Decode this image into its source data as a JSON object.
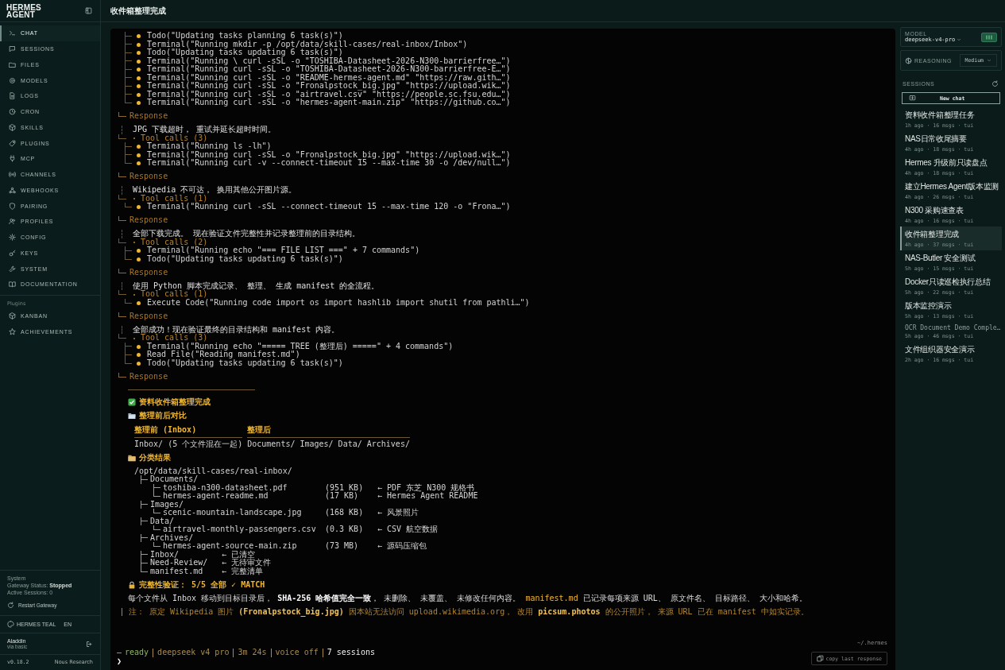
{
  "sidebar": {
    "brand": "HERMES AGENT",
    "nav": [
      {
        "label": "CHAT",
        "selected": true
      },
      {
        "label": "SESSIONS",
        "selected": false
      },
      {
        "label": "FILES",
        "selected": false
      },
      {
        "label": "MODELS",
        "selected": false
      },
      {
        "label": "LOGS",
        "selected": false
      },
      {
        "label": "CRON",
        "selected": false
      },
      {
        "label": "SKILLS",
        "selected": false
      },
      {
        "label": "PLUGINS",
        "selected": false
      },
      {
        "label": "MCP",
        "selected": false
      },
      {
        "label": "CHANNELS",
        "selected": false
      },
      {
        "label": "WEBHOOKS",
        "selected": false
      },
      {
        "label": "PAIRING",
        "selected": false
      },
      {
        "label": "PROFILES",
        "selected": false
      },
      {
        "label": "CONFIG",
        "selected": false
      },
      {
        "label": "KEYS",
        "selected": false
      },
      {
        "label": "SYSTEM",
        "selected": false
      },
      {
        "label": "DOCUMENTATION",
        "selected": false
      }
    ],
    "plugins_label": "Plugins",
    "plugins": [
      {
        "label": "KANBAN",
        "selected": false
      },
      {
        "label": "ACHIEVEMENTS",
        "selected": false
      }
    ],
    "system": {
      "label": "System",
      "gateway_label": "Gateway Status:",
      "gateway_status": "Stopped",
      "active_sessions": "Active Sessions: 0",
      "restart": "Restart Gateway"
    },
    "theme": "HERMES TEAL",
    "language": "EN",
    "user": {
      "name": "Aladdin",
      "auth": "via basic"
    },
    "version": "v0.18.2",
    "org": "Nous Research"
  },
  "header": {
    "title": "收件箱整理完成"
  },
  "transcript": {
    "steps": [
      {
        "calls": [
          "Todo(\"Updating tasks planning 6 task(s)\")",
          "Terminal(\"Running mkdir -p /opt/data/skill-cases/real-inbox/Inbox\")",
          "Todo(\"Updating tasks updating 6 task(s)\")",
          "Terminal(\"Running \\ curl -sSL -o \"TOSHIBA-Datasheet-2026-N300-barrierfree…\")",
          "Terminal(\"Running curl -sSL -o \"TOSHIBA-Datasheet-2026-N300-barrierfree-E…\")",
          "Terminal(\"Running curl -sSL -o \"README-hermes-agent.md\" \"https://raw.gith…\")",
          "Terminal(\"Running curl -sSL -o \"Fronalpstock_big.jpg\" \"https://upload.wik…\")",
          "Terminal(\"Running curl -sSL -o \"airtravel.csv\" \"https://people.sc.fsu.edu…\")",
          "Terminal(\"Running curl -sSL -o \"hermes-agent-main.zip\" \"https://github.co…\")"
        ],
        "response": "Response"
      },
      {
        "message": "JPG 下载超时， 重试并延长超时时间。",
        "tool_calls_label": "Tool calls (3)",
        "calls": [
          "Terminal(\"Running ls -lh\")",
          "Terminal(\"Running curl -sSL -o \"Fronalpstock_big.jpg\" \"https://upload.wik…\")",
          "Terminal(\"Running curl -v --connect-timeout 15 --max-time 30 -o /dev/null…\")"
        ],
        "response": "Response"
      },
      {
        "message": "Wikipedia 不可达， 换用其他公开图片源。",
        "tool_calls_label": "Tool calls (1)",
        "calls": [
          "Terminal(\"Running curl -sSL --connect-timeout 15 --max-time 120 -o \"Frona…\")"
        ],
        "response": "Response"
      },
      {
        "message": "全部下载完成。 现在验证文件完整性并记录整理前的目录结构。",
        "tool_calls_label": "Tool calls (2)",
        "calls": [
          "Terminal(\"Running echo \"=== FILE LIST ===\" + 7 commands\")",
          "Todo(\"Updating tasks updating 6 task(s)\")"
        ],
        "response": "Response"
      },
      {
        "message": "使用 Python 脚本完成记录、 整理、 生成 manifest 的全流程。",
        "tool_calls_label": "Tool calls (1)",
        "calls": [
          "Execute Code(\"Running code import os import hashlib import shutil from pathli…\")"
        ],
        "response": "Response"
      },
      {
        "message": "全部成功！现在验证最终的目录结构和 manifest 内容。",
        "tool_calls_label": "Tool calls (3)",
        "calls": [
          "Terminal(\"Running echo \"===== TREE (整理后) =====\" + 4 commands\")",
          "Read File(\"Reading manifest.md\")",
          "Todo(\"Updating tasks updating 6 task(s)\")"
        ],
        "response": "Response"
      }
    ],
    "result": {
      "title": "资料收件箱整理完成",
      "compare_title": "整理前后对比",
      "compare_table": {
        "columns": [
          "整理前 (Inbox)",
          "整理后"
        ],
        "rows": [
          [
            "Inbox/ (5 个文件混在一起)",
            "Documents/ Images/ Data/ Archives/"
          ]
        ]
      },
      "classify_title": "分类结果",
      "tree": {
        "name": "/opt/data/skill-cases/real-inbox/",
        "children": [
          {
            "name": "Documents/",
            "children": [
              {
                "name": "toshiba-n300-datasheet.pdf",
                "size": "(951 KB)",
                "note": "← PDF 东芝 N300 规格书"
              },
              {
                "name": "hermes-agent-readme.md",
                "size": "(17 KB)",
                "note": "← Hermes Agent README"
              }
            ]
          },
          {
            "name": "Images/",
            "children": [
              {
                "name": "scenic-mountain-landscape.jpg",
                "size": "(168 KB)",
                "note": "← 风景照片"
              }
            ]
          },
          {
            "name": "Data/",
            "children": [
              {
                "name": "airtravel-monthly-passengers.csv",
                "size": "(0.3 KB)",
                "note": "← CSV 航空数据"
              }
            ]
          },
          {
            "name": "Archives/",
            "children": [
              {
                "name": "hermes-agent-source-main.zip",
                "size": "(73 MB)",
                "note": "← 源码压缩包"
              }
            ]
          },
          {
            "name": "Inbox/",
            "note": "← 已清空"
          },
          {
            "name": "Need-Review/",
            "note": "← 无待审文件"
          },
          {
            "name": "manifest.md",
            "note": "← 完整清单"
          }
        ]
      },
      "verify": "完整性验证： 5/5 全部 ✓ MATCH",
      "paragraph": [
        {
          "kind": "plain",
          "text": "每个文件从 Inbox 移动到目标目录后， "
        },
        {
          "kind": "bold",
          "text": "SHA-256 哈希值完全一致"
        },
        {
          "kind": "plain",
          "text": "， 未删除、 未覆盖、 未修改任何内容。 "
        },
        {
          "kind": "code",
          "text": "manifest.md"
        },
        {
          "kind": "plain",
          "text": " 已记录每项来源 URL、 原文件名、 目标路径、 大小和哈希。"
        }
      ],
      "note": [
        {
          "kind": "plain",
          "text": "注： 原定 Wikipedia 图片 "
        },
        {
          "kind": "bright",
          "text": "(Fronalpstock_big.jpg)"
        },
        {
          "kind": "plain",
          "text": " 因本站无法访问 upload.wikimedia.org， 改用 "
        },
        {
          "kind": "bright",
          "text": "picsum.photos"
        },
        {
          "kind": "plain",
          "text": " 的公开照片， 来源 URL 已在 manifest 中如实记录。"
        }
      ]
    },
    "status_bar": [
      {
        "kind": "status",
        "text": "ready"
      },
      {
        "kind": "info",
        "text": "deepseek v4 pro"
      },
      {
        "kind": "info",
        "text": "3m 24s"
      },
      {
        "kind": "info",
        "text": "voice off"
      },
      {
        "kind": "count",
        "text": "7 sessions"
      }
    ],
    "prompt": "❯",
    "cwd": "~/.hermes",
    "copy_button": "copy last response"
  },
  "right_panel": {
    "model_label": "MODEL",
    "model": "deepseek-v4-pro",
    "reasoning_label": "REASONING",
    "reasoning": "Medium",
    "sessions_label": "SESSIONS",
    "new_chat": "New chat",
    "sessions": [
      {
        "title": "资料收件箱整理任务",
        "meta": "1h ago · 16 msgs · tui",
        "selected": false
      },
      {
        "title": "NAS日常收尾摘要",
        "meta": "4h ago · 18 msgs · tui",
        "selected": false
      },
      {
        "title": "Hermes 升级前只读盘点",
        "meta": "4h ago · 18 msgs · tui",
        "selected": false
      },
      {
        "title": "建立Hermes Agent版本监测",
        "meta": "4h ago · 26 msgs · tui",
        "selected": false
      },
      {
        "title": "N300 采购速查表",
        "meta": "4h ago · 16 msgs · tui",
        "selected": false
      },
      {
        "title": "收件箱整理完成",
        "meta": "4h ago · 37 msgs · tui",
        "selected": true
      },
      {
        "title": "NAS-Butler 安全测试",
        "meta": "5h ago · 15 msgs · tui",
        "selected": false
      },
      {
        "title": "Docker只读巡检执行总结",
        "meta": "5h ago · 22 msgs · tui",
        "selected": false
      },
      {
        "title": "版本监控演示",
        "meta": "5h ago · 13 msgs · tui",
        "selected": false
      },
      {
        "title": "OCR Document Demo Comple…",
        "meta": "5h ago · 46 msgs · tui",
        "selected": false
      },
      {
        "title": "文件组织器安全演示",
        "meta": "2h ago · 16 msgs · tui",
        "selected": false
      }
    ]
  }
}
